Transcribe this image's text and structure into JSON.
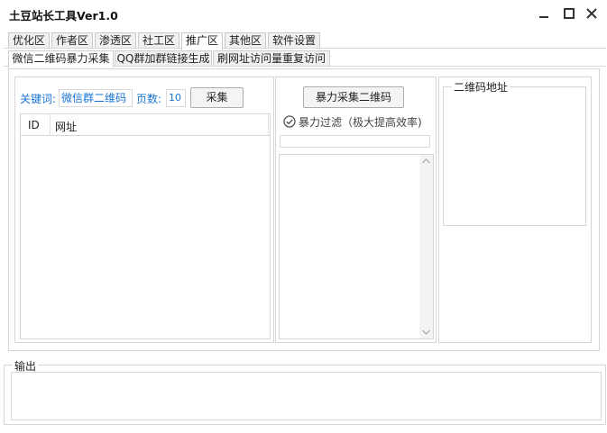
{
  "window": {
    "title": "土豆站长工具Ver1.0"
  },
  "top_tabs": [
    {
      "label": "优化区"
    },
    {
      "label": "作者区"
    },
    {
      "label": "渗透区"
    },
    {
      "label": "社工区"
    },
    {
      "label": "推广区"
    },
    {
      "label": "其他区"
    },
    {
      "label": "软件设置"
    }
  ],
  "sub_tabs": [
    {
      "label": "微信二维码暴力采集"
    },
    {
      "label": "QQ群加群链接生成"
    },
    {
      "label": "刷网址访问量重复访问"
    }
  ],
  "left_panel": {
    "keyword_label": "关键词:",
    "keyword_value": "微信群二维码",
    "pages_label": "页数:",
    "pages_value": "10",
    "collect_button": "采集",
    "columns": [
      "ID",
      "网址"
    ]
  },
  "middle_panel": {
    "brute_button": "暴力采集二维码",
    "filter_label": "暴力过滤（极大提高效率)",
    "filter_checked": true
  },
  "right_panel": {
    "group_title": "二维码地址"
  },
  "output": {
    "group_title": "输出"
  }
}
